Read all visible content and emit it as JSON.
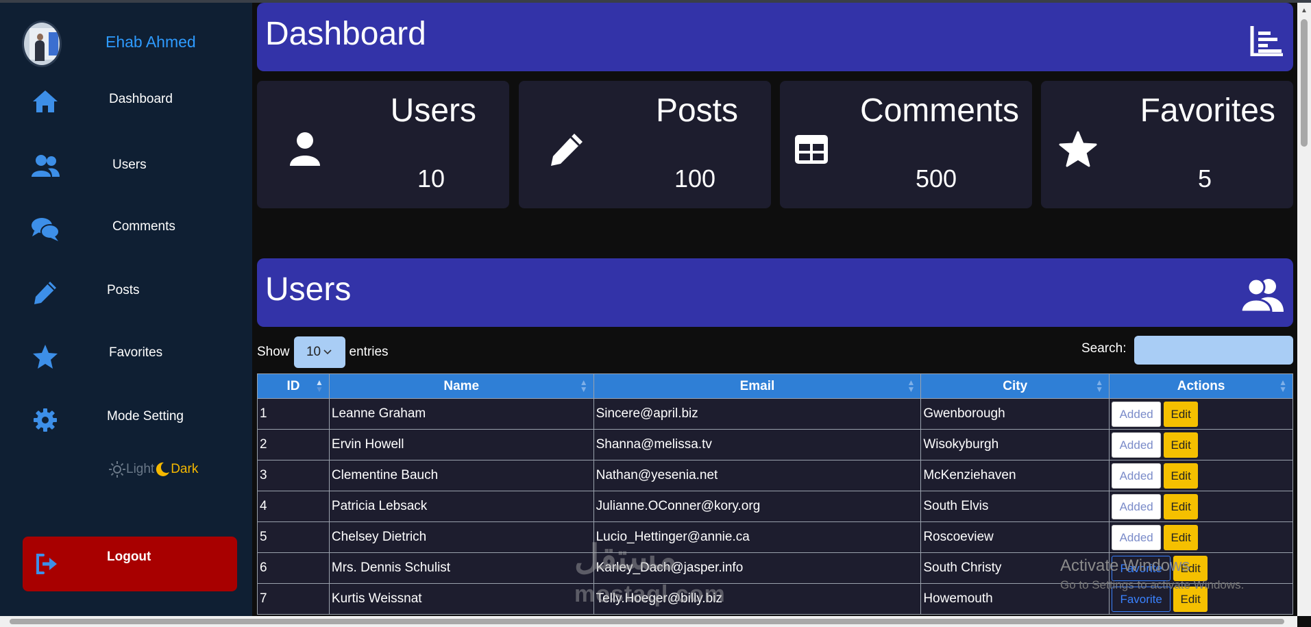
{
  "sidebar": {
    "username": "Ehab Ahmed",
    "items": [
      {
        "label": "Dashboard",
        "icon": "home-icon"
      },
      {
        "label": "Users",
        "icon": "users-icon"
      },
      {
        "label": "Comments",
        "icon": "comments-icon"
      },
      {
        "label": "Posts",
        "icon": "pencil-icon"
      },
      {
        "label": "Favorites",
        "icon": "star-icon"
      },
      {
        "label": "Mode Setting",
        "icon": "gear-icon"
      }
    ],
    "mode_light": "Light",
    "mode_dark": "Dark",
    "logout": "Logout"
  },
  "dashboard": {
    "title": "Dashboard",
    "cards": [
      {
        "title": "Users",
        "value": "10",
        "icon": "user-icon"
      },
      {
        "title": "Posts",
        "value": "100",
        "icon": "pencil-icon"
      },
      {
        "title": "Comments",
        "value": "500",
        "icon": "table-icon"
      },
      {
        "title": "Favorites",
        "value": "5",
        "icon": "star-icon"
      }
    ]
  },
  "users_section": {
    "title": "Users",
    "show_label": "Show",
    "entries_value": "10",
    "entries_label": "entries",
    "search_label": "Search:",
    "columns": [
      "ID",
      "Name",
      "Email",
      "City",
      "Actions"
    ],
    "rows": [
      {
        "id": "1",
        "name": "Leanne Graham",
        "email": "Sincere@april.biz",
        "city": "Gwenborough",
        "fav": "Added",
        "edit": "Edit"
      },
      {
        "id": "2",
        "name": "Ervin Howell",
        "email": "Shanna@melissa.tv",
        "city": "Wisokyburgh",
        "fav": "Added",
        "edit": "Edit"
      },
      {
        "id": "3",
        "name": "Clementine Bauch",
        "email": "Nathan@yesenia.net",
        "city": "McKenziehaven",
        "fav": "Added",
        "edit": "Edit"
      },
      {
        "id": "4",
        "name": "Patricia Lebsack",
        "email": "Julianne.OConner@kory.org",
        "city": "South Elvis",
        "fav": "Added",
        "edit": "Edit"
      },
      {
        "id": "5",
        "name": "Chelsey Dietrich",
        "email": "Lucio_Hettinger@annie.ca",
        "city": "Roscoeview",
        "fav": "Added",
        "edit": "Edit"
      },
      {
        "id": "6",
        "name": "Mrs. Dennis Schulist",
        "email": "Karley_Dach@jasper.info",
        "city": "South Christy",
        "fav": "Favorite",
        "edit": "Edit"
      },
      {
        "id": "7",
        "name": "Kurtis Weissnat",
        "email": "Telly.Hoeger@billy.biz",
        "city": "Howemouth",
        "fav": "Favorite",
        "edit": "Edit"
      }
    ]
  },
  "overlay": {
    "activate_title": "Activate Windows",
    "activate_sub": "Go to Settings to activate Windows.",
    "watermark_top": "مستقل",
    "watermark_bottom": "mostaql.com"
  },
  "colors": {
    "sidebar_bg": "#0f1f33",
    "header_bg": "#3333a8",
    "card_bg": "#1d1d2e",
    "accent_blue": "#2e9bff",
    "logout_bg": "#a80000",
    "edit_btn": "#f5c000",
    "table_header": "#2f7fd6"
  }
}
